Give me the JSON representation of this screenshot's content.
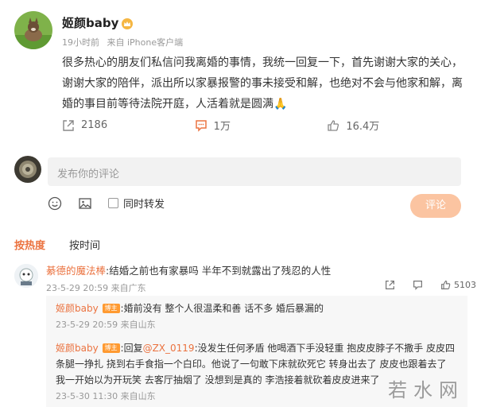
{
  "post": {
    "author": "姬颜baby",
    "time": "19小时前",
    "source": "来自 iPhone客户端",
    "text": "很多热心的朋友们私信问我离婚的事情，我统一回复一下，首先谢谢大家的关心，谢谢大家的陪伴，派出所以家暴报警的事未接受和解，也绝对不会与他家和解，离婚的事目前等待法院开庭，人活着就是圆满🙏",
    "reposts": "2186",
    "comments": "1万",
    "likes": "16.4万"
  },
  "composer": {
    "placeholder": "发布你的评论",
    "repost_label": "同时转发",
    "submit_label": "评论"
  },
  "sort_tabs": [
    "按热度",
    "按时间"
  ],
  "comment": {
    "user": "綦德的魔法棒",
    "text": ":结婚之前也有家暴吗 半年不到就露出了残忍的人性",
    "meta": "23-5-29 20:59 来自广东",
    "like_count": "5103"
  },
  "replies": [
    {
      "user": "姬颜baby",
      "badge": "博主",
      "text": ":婚前没有 整个人很温柔和善 话不多  婚后暴漏的",
      "meta": "23-5-29 20:59 来自山东"
    },
    {
      "user": "姬颜baby",
      "badge": "博主",
      "prefix": ":回复",
      "mention": "@ZX_0119",
      "text": ":没发生任何矛盾 他喝酒下手没轻重 抱皮皮脖子不撒手 皮皮四条腿一挣扎 挠到右手食指一个白印。他说了一句敢下床就砍死它 转身出去了 皮皮也跟着去了 我一开始以为开玩笑 去客厅抽烟了 没想到是真的 李浩接着就砍着皮皮进来了",
      "meta": "23-5-30 11:30 来自山东"
    }
  ],
  "watermark": "若水网",
  "colors": {
    "accent": "#eb7340",
    "badge": "#ff9a31",
    "button": "#fbc4a1"
  }
}
